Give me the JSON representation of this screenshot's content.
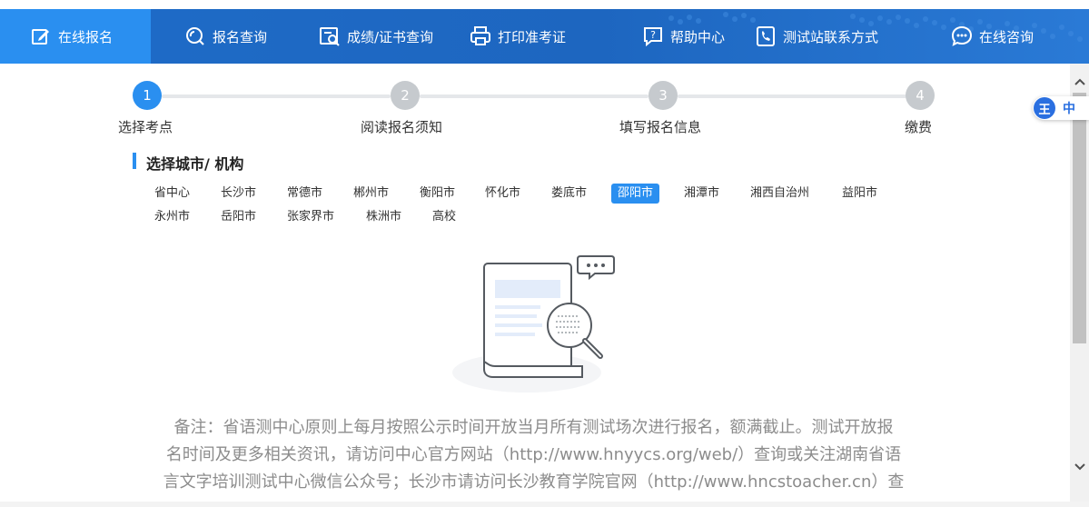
{
  "nav": {
    "items": [
      {
        "label": "在线报名",
        "icon": "edit-icon"
      },
      {
        "label": "报名查询",
        "icon": "search-icon"
      },
      {
        "label": "成绩/证书查询",
        "icon": "certificate-search-icon"
      },
      {
        "label": "打印准考证",
        "icon": "printer-icon"
      },
      {
        "label": "帮助中心",
        "icon": "help-icon"
      },
      {
        "label": "测试站联系方式",
        "icon": "phone-icon"
      },
      {
        "label": "在线咨询",
        "icon": "chat-icon"
      }
    ],
    "active_index": 0,
    "colors": {
      "bar": "#1f6cc8",
      "active": "#2a8ff0"
    }
  },
  "steps": [
    {
      "number": "1",
      "label": "选择考点",
      "state": "current"
    },
    {
      "number": "2",
      "label": "阅读报名须知",
      "state": "pending"
    },
    {
      "number": "3",
      "label": "填写报名信息",
      "state": "pending"
    },
    {
      "number": "4",
      "label": "缴费",
      "state": "pending"
    }
  ],
  "section": {
    "title": "选择城市/ 机构"
  },
  "cities": {
    "row1": [
      "省中心",
      "长沙市",
      "常德市",
      "郴州市",
      "衡阳市",
      "怀化市",
      "娄底市",
      "邵阳市",
      "湘潭市",
      "湘西自治州",
      "益阳市"
    ],
    "row2": [
      "永州市",
      "岳阳市",
      "张家界市",
      "株洲市",
      "高校"
    ],
    "selected": "邵阳市"
  },
  "empty_state": {
    "icon": "document-search-illustration"
  },
  "note": {
    "line1": "备注：省语测中心原则上每月按照公示时间开放当月所有测试场次进行报名，额满截止。测试开放报",
    "line2": "名时间及更多相关资讯，请访问中心官方网站（http://www.hnyycs.org/web/）查询或关注湖南省语",
    "line3": "言文字培训测试中心微信公众号；长沙市请访问长沙教育学院官网（http://www.hncstoacher.cn）查"
  },
  "ime": {
    "logo": "王",
    "mode": "中"
  },
  "colors": {
    "accent": "#2a8ff0",
    "step_inactive": "#c6cace",
    "note_text": "#8c8c8c"
  }
}
